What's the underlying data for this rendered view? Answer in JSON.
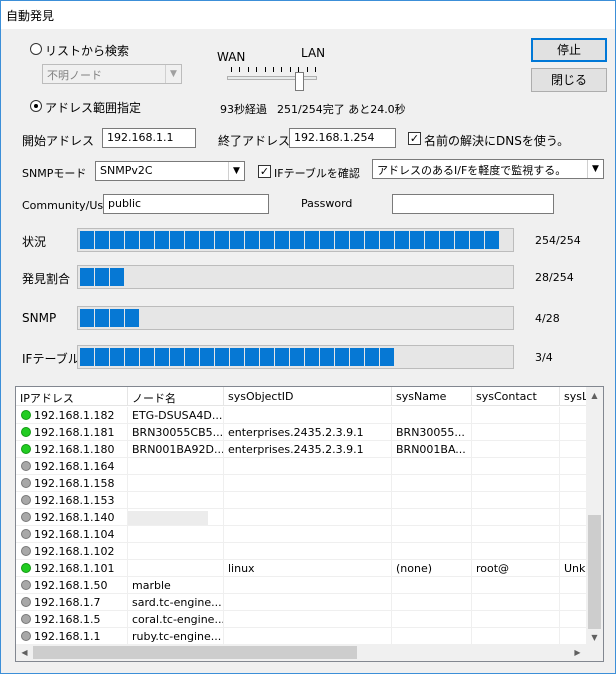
{
  "window": {
    "title": "自動発見"
  },
  "mode": {
    "list_search_label": "リストから検索",
    "list_select_value": "不明ノード",
    "range_label": "アドレス範囲指定"
  },
  "slider": {
    "wan_label": "WAN",
    "lan_label": "LAN",
    "level": 0.85
  },
  "progress_text": {
    "elapsed": "93秒経過",
    "status": "251/254完了 あと24.0秒"
  },
  "buttons": {
    "stop": "停止",
    "close": "閉じる"
  },
  "address": {
    "start_label": "開始アドレス",
    "start_value": "192.168.1.1",
    "end_label": "終了アドレス",
    "end_value": "192.168.1.254",
    "dns_label": "名前の解決にDNSを使う。",
    "dns_checked": true
  },
  "snmp": {
    "mode_label": "SNMPモード",
    "mode_value": "SNMPv2C",
    "if_check_label": "IFテーブルを確認",
    "if_checked": true,
    "if_mode_value": "アドレスのあるI/Fを軽度で監視する。",
    "community_label": "Community/User",
    "community_value": "public",
    "password_label": "Password",
    "password_value": ""
  },
  "bars": [
    {
      "label": "状況",
      "value": "254/254",
      "done": 254,
      "total": 254
    },
    {
      "label": "発見割合",
      "value": "28/254",
      "done": 28,
      "total": 254
    },
    {
      "label": "SNMP",
      "value": "4/28",
      "done": 4,
      "total": 28
    },
    {
      "label": "IFテーブル",
      "value": "3/4",
      "done": 3,
      "total": 4
    }
  ],
  "table": {
    "headers": [
      "IPアドレス",
      "ノード名",
      "sysObjectID",
      "sysName",
      "sysContact",
      "sysLo"
    ],
    "rows": [
      {
        "status": "green",
        "ip": "192.168.1.182",
        "name": "ETG-DSUSA4D...",
        "oid": "",
        "sysname": "",
        "contact": "",
        "loc": ""
      },
      {
        "status": "green",
        "ip": "192.168.1.181",
        "name": "BRN30055CB5...",
        "oid": "enterprises.2435.2.3.9.1",
        "sysname": "BRN30055...",
        "contact": "",
        "loc": ""
      },
      {
        "status": "green",
        "ip": "192.168.1.180",
        "name": "BRN001BA92D...",
        "oid": "enterprises.2435.2.3.9.1",
        "sysname": "BRN001BA...",
        "contact": "",
        "loc": ""
      },
      {
        "status": "gray",
        "ip": "192.168.1.164",
        "name": "",
        "oid": "",
        "sysname": "",
        "contact": "",
        "loc": ""
      },
      {
        "status": "gray",
        "ip": "192.168.1.158",
        "name": "",
        "oid": "",
        "sysname": "",
        "contact": "",
        "loc": ""
      },
      {
        "status": "gray",
        "ip": "192.168.1.153",
        "name": "",
        "oid": "",
        "sysname": "",
        "contact": "",
        "loc": ""
      },
      {
        "status": "gray",
        "ip": "192.168.1.140",
        "name": "",
        "oid": "",
        "sysname": "",
        "contact": "",
        "loc": ""
      },
      {
        "status": "gray",
        "ip": "192.168.1.104",
        "name": "",
        "oid": "",
        "sysname": "",
        "contact": "",
        "loc": ""
      },
      {
        "status": "gray",
        "ip": "192.168.1.102",
        "name": "",
        "oid": "",
        "sysname": "",
        "contact": "",
        "loc": ""
      },
      {
        "status": "green",
        "ip": "192.168.1.101",
        "name": "",
        "oid": "linux",
        "sysname": "(none)",
        "contact": "root@",
        "loc": "Unkn"
      },
      {
        "status": "gray",
        "ip": "192.168.1.50",
        "name": "marble",
        "oid": "",
        "sysname": "",
        "contact": "",
        "loc": ""
      },
      {
        "status": "gray",
        "ip": "192.168.1.7",
        "name": "sard.tc-engine...",
        "oid": "",
        "sysname": "",
        "contact": "",
        "loc": ""
      },
      {
        "status": "gray",
        "ip": "192.168.1.5",
        "name": "coral.tc-engine...",
        "oid": "",
        "sysname": "",
        "contact": "",
        "loc": ""
      },
      {
        "status": "gray",
        "ip": "192.168.1.1",
        "name": "ruby.tc-engine...",
        "oid": "",
        "sysname": "",
        "contact": "",
        "loc": ""
      }
    ]
  },
  "colors": {
    "progress": "#0678d4",
    "status_green": "#22cc22",
    "status_gray": "#a8a8a8",
    "accent": "#0078d7"
  }
}
